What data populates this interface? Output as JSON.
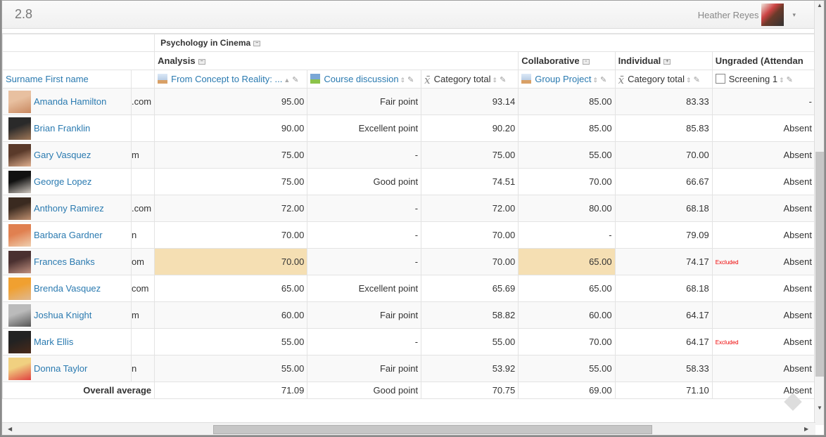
{
  "topbar": {
    "version": "2.8",
    "user_name": "Heather Reyes",
    "caret": "▾"
  },
  "headers": {
    "course": "Psychology in Cinema",
    "categories": [
      {
        "label": "Analysis",
        "icon": "collapse-icon"
      },
      {
        "label": "Collaborative",
        "icon": "expand-icon"
      },
      {
        "label": "Individual",
        "icon": "plus-icon"
      },
      {
        "label": "Ungraded (Attendan",
        "icon": ""
      }
    ],
    "name_column": "Surname First name",
    "columns": [
      {
        "label": "From Concept to Reality: ...",
        "icon": "assignment-icon",
        "sort": "▲",
        "link": true
      },
      {
        "label": "Course discussion",
        "icon": "forum-icon",
        "sort": "⇕",
        "link": true
      },
      {
        "label": "Category total",
        "icon": "mean-icon",
        "sort": "⇕",
        "link": false
      },
      {
        "label": "Group Project",
        "icon": "assignment-icon",
        "sort": "⇕",
        "link": true
      },
      {
        "label": "Category total",
        "icon": "mean-icon",
        "sort": "⇕",
        "link": false
      },
      {
        "label": "Screening 1",
        "icon": "edit-item-icon",
        "sort": "⇕",
        "link": false
      }
    ]
  },
  "students": [
    {
      "name": "Amanda Hamilton",
      "email": ".com",
      "grades": [
        "95.00",
        "Fair point",
        "93.14",
        "85.00",
        "83.33",
        "-"
      ],
      "highlight": [],
      "excluded": false,
      "colors": [
        "#e8c0a0",
        "#c88860"
      ]
    },
    {
      "name": "Brian Franklin",
      "email": "",
      "grades": [
        "90.00",
        "Excellent point",
        "90.20",
        "85.00",
        "85.83",
        "Absent"
      ],
      "highlight": [],
      "excluded": false,
      "colors": [
        "#2a2a2a",
        "#a07858"
      ]
    },
    {
      "name": "Gary Vasquez",
      "email": "m",
      "grades": [
        "75.00",
        "-",
        "75.00",
        "55.00",
        "70.00",
        "Absent"
      ],
      "highlight": [],
      "excluded": false,
      "colors": [
        "#5a3a2a",
        "#e0b090"
      ]
    },
    {
      "name": "George Lopez",
      "email": "",
      "grades": [
        "75.00",
        "Good point",
        "74.51",
        "70.00",
        "66.67",
        "Absent"
      ],
      "highlight": [],
      "excluded": false,
      "colors": [
        "#111",
        "#d0c8c0"
      ]
    },
    {
      "name": "Anthony Ramirez",
      "email": ".com",
      "grades": [
        "72.00",
        "-",
        "72.00",
        "80.00",
        "68.18",
        "Absent"
      ],
      "highlight": [],
      "excluded": false,
      "colors": [
        "#3a2a20",
        "#c09070"
      ]
    },
    {
      "name": "Barbara Gardner",
      "email": "n",
      "grades": [
        "70.00",
        "-",
        "70.00",
        "-",
        "79.09",
        "Absent"
      ],
      "highlight": [],
      "excluded": false,
      "colors": [
        "#e08050",
        "#f0d0b0"
      ]
    },
    {
      "name": "Frances Banks",
      "email": "om",
      "grades": [
        "70.00",
        "-",
        "70.00",
        "65.00",
        "74.17",
        "Absent"
      ],
      "highlight": [
        0,
        3
      ],
      "excluded": true,
      "colors": [
        "#4a3030",
        "#c09080"
      ]
    },
    {
      "name": "Brenda Vasquez",
      "email": "com",
      "grades": [
        "65.00",
        "Excellent point",
        "65.69",
        "65.00",
        "68.18",
        "Absent"
      ],
      "highlight": [],
      "excluded": false,
      "colors": [
        "#f0a030",
        "#e0b890"
      ]
    },
    {
      "name": "Joshua Knight",
      "email": "m",
      "grades": [
        "60.00",
        "Fair point",
        "58.82",
        "60.00",
        "64.17",
        "Absent"
      ],
      "highlight": [],
      "excluded": false,
      "colors": [
        "#bbb",
        "#555"
      ]
    },
    {
      "name": "Mark Ellis",
      "email": "",
      "grades": [
        "55.00",
        "-",
        "55.00",
        "70.00",
        "64.17",
        "Absent"
      ],
      "highlight": [],
      "excluded": true,
      "colors": [
        "#222",
        "#4a2a1a"
      ]
    },
    {
      "name": "Donna Taylor",
      "email": "n",
      "grades": [
        "55.00",
        "Fair point",
        "53.92",
        "55.00",
        "58.33",
        "Absent"
      ],
      "highlight": [],
      "excluded": false,
      "colors": [
        "#f0d080",
        "#e04040"
      ]
    }
  ],
  "overall": {
    "label": "Overall average",
    "values": [
      "71.09",
      "Good point",
      "70.75",
      "69.00",
      "71.10",
      "Absent"
    ]
  },
  "excluded_label": "Excluded"
}
